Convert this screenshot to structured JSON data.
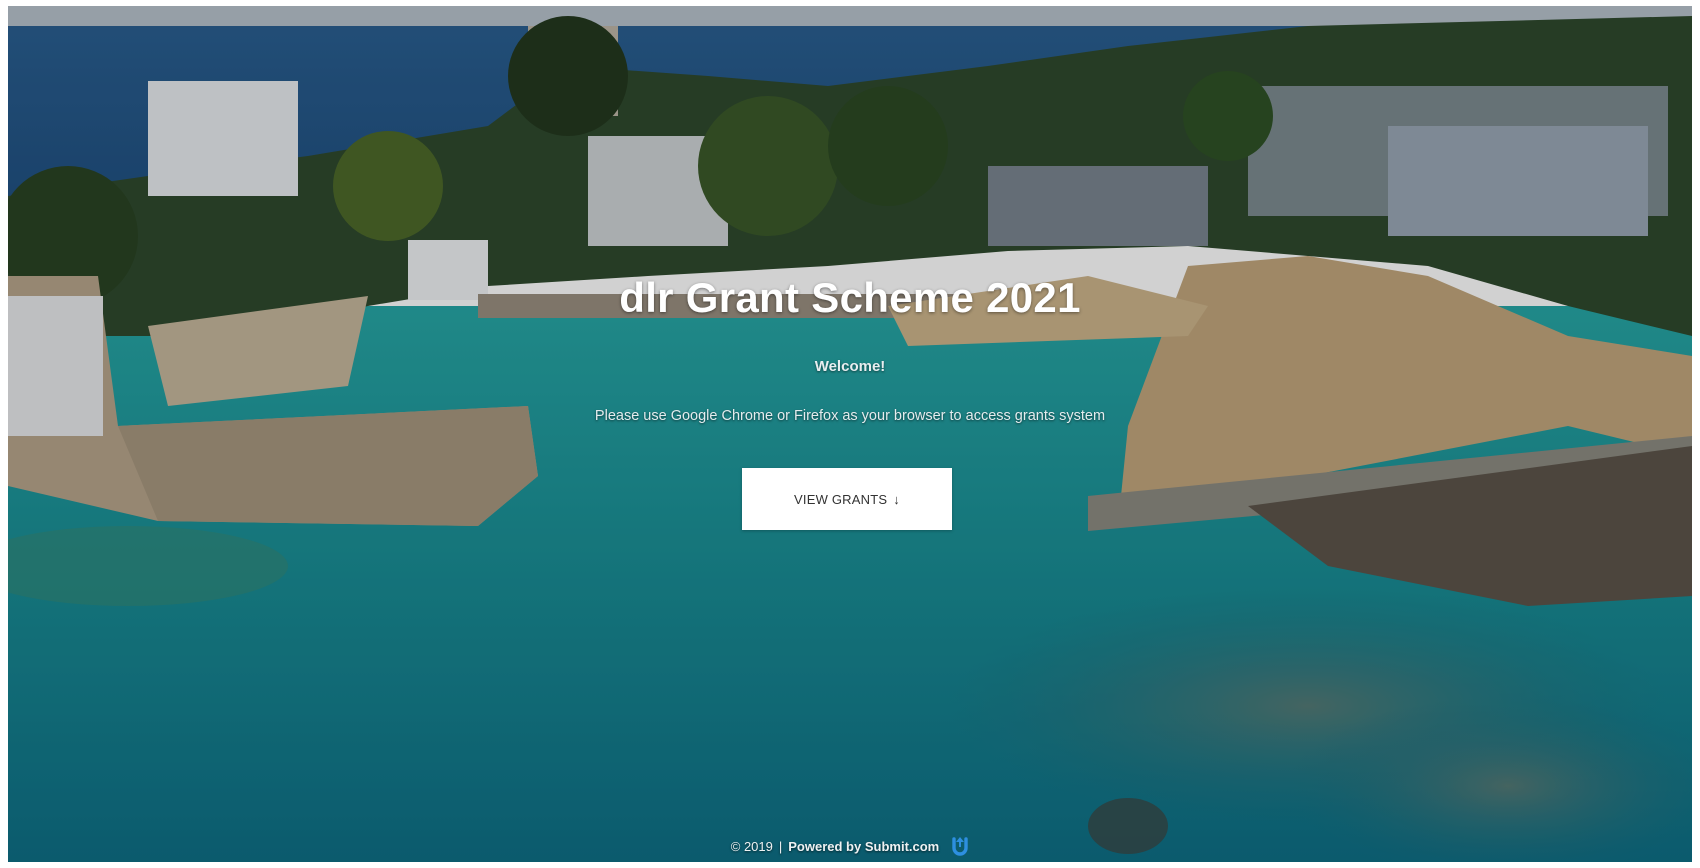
{
  "hero": {
    "title": "dlr Grant Scheme 2021",
    "welcome": "Welcome!",
    "browser_note": "Please use Google Chrome or Firefox as your browser to access grants system",
    "cta_label": "VIEW GRANTS",
    "cta_icon": "arrow-down-icon"
  },
  "footer": {
    "copyright": "© 2019",
    "separator": "|",
    "powered_by": "Powered by Submit.com",
    "logo_icon": "submit-logo-icon"
  },
  "colors": {
    "sea": "#1f8f95",
    "sea_deep": "#0f5f78",
    "sky_sea": "#2a5d8c",
    "button_bg": "#ffffff",
    "logo_blue": "#2d8fe0"
  }
}
